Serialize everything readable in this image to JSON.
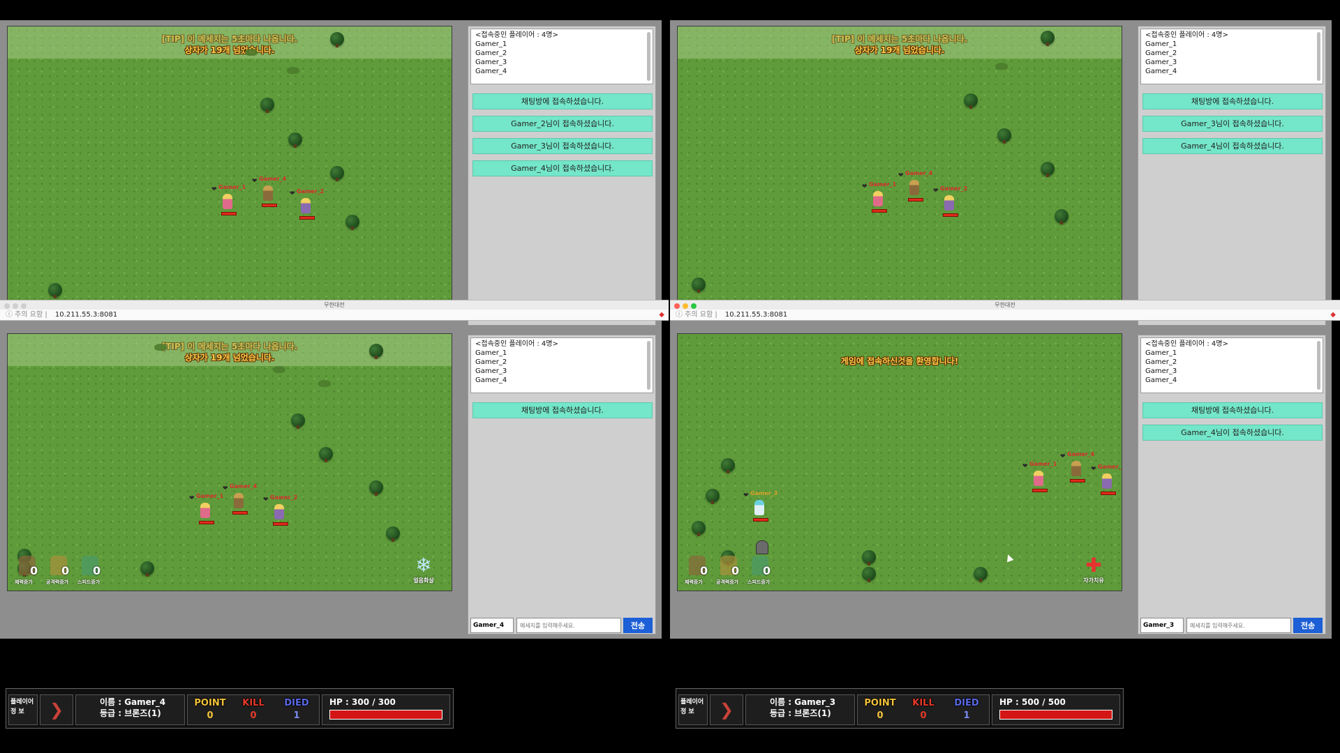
{
  "tip_line1": "[TIP] 이 메세지는 5초마다 나옵니다.",
  "tip_line2": "상자가 19개 넘었습니다.",
  "top_message_q3": "게임에 접속하신것을 환영합니다!",
  "players_header": "<접속중인 플레이어 : 4명>",
  "players": [
    "Gamer_1",
    "Gamer_2",
    "Gamer_3",
    "Gamer_4"
  ],
  "window_title": "무한대전",
  "address": {
    "warning": "ⓘ 주의 요함",
    "separator": "|",
    "ip": "10.211.55.3:8081"
  },
  "chat": {
    "q0": [
      "채팅방에 접속하셨습니다.",
      "Gamer_2님이 접속하셨습니다.",
      "Gamer_3님이 접속하셨습니다.",
      "Gamer_4님이 접속하셨습니다."
    ],
    "q1": [
      "채팅방에 접속하셨습니다.",
      "Gamer_3님이 접속하셨습니다.",
      "Gamer_4님이 접속하셨습니다."
    ],
    "q2": [
      "채팅방에 접속하셨습니다."
    ],
    "q3": [
      "채팅방에 접속하셨습니다.",
      "Gamer_4님이 접속하셨습니다."
    ]
  },
  "input_placeholder": "메세지를 입력해주세요.",
  "send_label": "전송",
  "skills": {
    "hp_up": "체력증가",
    "atk_up": "공격력증가",
    "speed_up": "스피드증가",
    "count": "0",
    "ice": "얼음화살",
    "heal": "자가치유"
  },
  "hud": {
    "info_line1": "플레이어",
    "info_line2": "정   보",
    "point_label": "POINT",
    "kill_label": "KILL",
    "died_label": "DIED",
    "q2": {
      "name": "이름 : Gamer_4",
      "grade": "등급 : 브론즈(1)",
      "point": "0",
      "kill": "0",
      "died": "1",
      "hp": "HP : 300 / 300",
      "nick": "Gamer_4"
    },
    "q3": {
      "name": "이름 : Gamer_3",
      "grade": "등급 : 브론즈(1)",
      "point": "0",
      "kill": "0",
      "died": "1",
      "hp": "HP : 500 / 500",
      "nick": "Gamer_3"
    }
  },
  "char_names": {
    "g1": "Gamer_1",
    "g2": "Gamer_2",
    "g3": "Gamer_3",
    "g4": "Gamer_4"
  },
  "colors": {
    "chat_bubble": "#74e6c9",
    "hp_bar": "#d31515",
    "send_button": "#1c5fd6",
    "name_text": "#d92b2b",
    "tip_text": "#ffce4a"
  }
}
